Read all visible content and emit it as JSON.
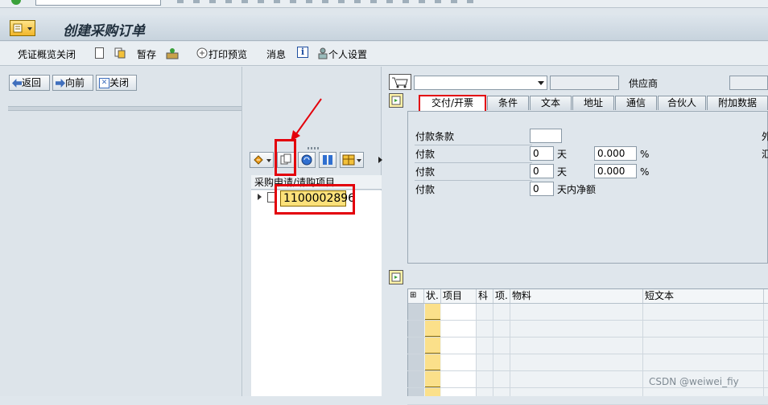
{
  "header": {
    "title": "创建采购订单"
  },
  "toolbar": {
    "doc_overview_off": "凭证概览关闭",
    "hold": "暂存",
    "print_preview": "打印预览",
    "messages": "消息",
    "personal_settings": "个人设置"
  },
  "nav": {
    "back": "返回",
    "forward": "向前",
    "close": "关闭"
  },
  "tree": {
    "header": "采购申请/请购项目",
    "item": "1100002896"
  },
  "po_header": {
    "vendor_label": "供应商",
    "doc_type_value": "",
    "vendor_value": ""
  },
  "tabs": [
    "交付/开票",
    "条件",
    "文本",
    "地址",
    "通信",
    "合伙人",
    "附加数据"
  ],
  "delivery": {
    "payment_terms_label": "付款条款",
    "payment_terms_value": "",
    "rows": [
      {
        "label": "付款",
        "days": "0",
        "unit": "天",
        "pct": "0.000",
        "pct_sign": "%"
      },
      {
        "label": "付款",
        "days": "0",
        "unit": "天",
        "pct": "0.000",
        "pct_sign": "%"
      },
      {
        "label": "付款",
        "days": "0",
        "unit": "天内净额"
      }
    ],
    "right_cut_1": "外",
    "right_cut_2": "汇"
  },
  "items_table": {
    "columns": [
      "状.",
      "项目",
      "科",
      "项.",
      "物料",
      "短文本"
    ]
  },
  "watermark": "CSDN @weiwei_fiy",
  "colors": {
    "highlight_red": "#e3000b",
    "active_item_bg": "#fce17a"
  }
}
